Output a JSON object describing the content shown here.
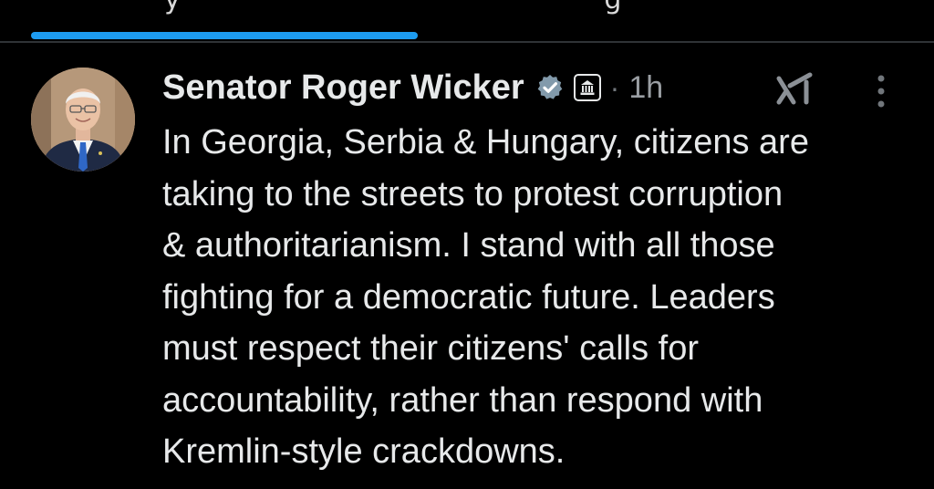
{
  "tab_bar": {
    "active_indicator_color": "#1d9bf0"
  },
  "post": {
    "author": {
      "display_name": "Senator Roger Wicker",
      "verified_icon": "gray-verified-checkmark-icon",
      "affiliation_badge_icon": "government-building-icon"
    },
    "separator": "·",
    "timestamp": "1h",
    "actions": {
      "grok_icon": "grok-icon",
      "more_icon": "vertical-ellipsis-icon"
    },
    "text": "In Georgia, Serbia & Hungary, citizens are\ntaking to the streets to protest corruption\n& authoritarianism. I stand with all those\nfighting for a democratic future. Leaders\nmust respect their citizens' calls for\naccountability, rather than respond with\nKremlin-style crackdowns."
  },
  "colors": {
    "background": "#000000",
    "primary_text": "#e7e9ea",
    "secondary_text": "#71767b",
    "accent": "#1d9bf0",
    "divider": "#2f3336"
  }
}
